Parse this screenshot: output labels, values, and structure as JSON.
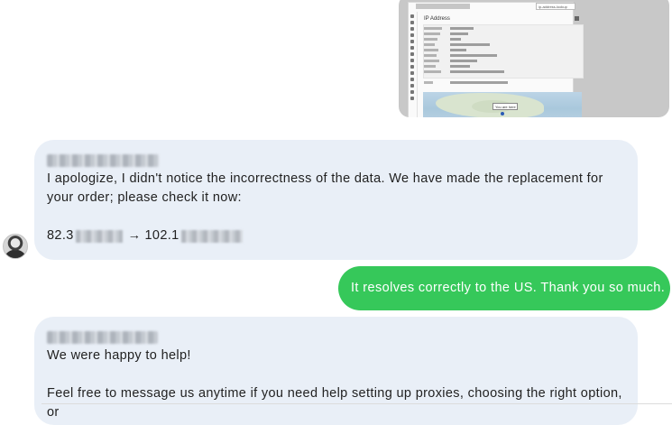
{
  "attachment": {
    "search_text": "ip-address-lookup",
    "panel_title": "IP Address",
    "map_popup": "You are here"
  },
  "messages": [
    {
      "direction": "incoming",
      "sender_redacted": true,
      "lines": [
        "I apologize, I didn't notice the incorrectness of the data. We have made the replacement for your order; please check it now:"
      ],
      "ip_from_prefix": "82.3",
      "arrow": "→",
      "ip_to_prefix": "102.1"
    },
    {
      "direction": "outgoing",
      "text": "It resolves correctly to the US. Thank you so much."
    },
    {
      "direction": "incoming",
      "sender_redacted": true,
      "line1": "We were happy to help!",
      "line2": "Feel free to message us anytime if you need help setting up proxies, choosing the right option, or"
    }
  ],
  "colors": {
    "incoming_bubble": "#e9eff7",
    "outgoing_bubble": "#36c85a",
    "text": "#222222"
  }
}
